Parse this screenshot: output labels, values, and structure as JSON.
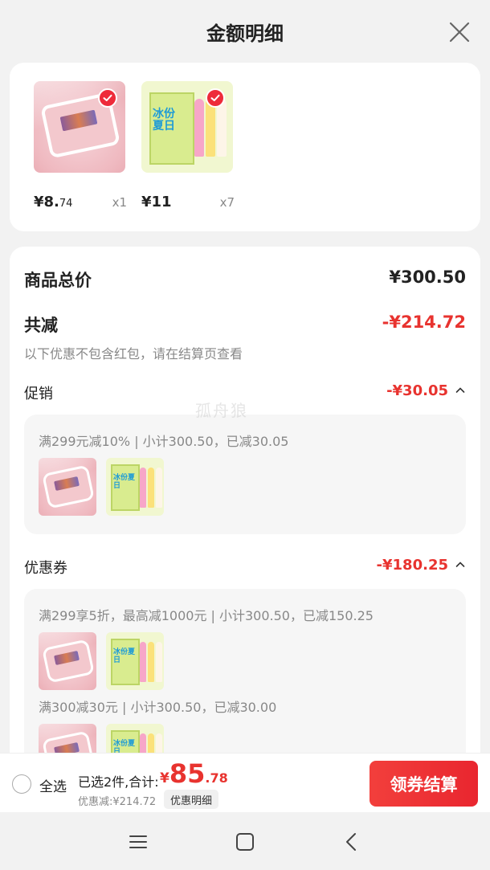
{
  "header": {
    "title": "金额明细"
  },
  "products": [
    {
      "price_main": "¥8.",
      "price_small": "74",
      "qty": "x1",
      "image": "pink-ice-cream-boxes"
    },
    {
      "price_main": "¥11",
      "price_small": "",
      "qty": "x7",
      "image": "green-popsicle-box",
      "box_text": "冰份夏日"
    }
  ],
  "summary": {
    "total_label": "商品总价",
    "total_value": "¥300.50",
    "reduce_label": "共减",
    "reduce_value": "-¥214.72",
    "note": "以下优惠不包含红包，请在结算页查看"
  },
  "promo": {
    "label": "促销",
    "value": "-¥30.05",
    "rule": "满299元减10% | 小计300.50，已减30.05"
  },
  "coupon": {
    "label": "优惠券",
    "value": "-¥180.25",
    "rule1": "满299享5折，最高减1000元 | 小计300.50，已减150.25",
    "rule2": "满300减30元 | 小计300.50，已减30.00"
  },
  "watermark": "孤舟狼",
  "bottom": {
    "select_all": "全选",
    "selected": "已选2件,合计:",
    "currency": "¥",
    "total_int": "85",
    "total_dec": ".78",
    "discount": "优惠减:¥214.72",
    "detail_chip": "优惠明细",
    "checkout": "领券结算"
  },
  "colors": {
    "accent": "#e8332f",
    "button": "#ee2b35",
    "card": "#ffffff",
    "page": "#f2f2f2"
  }
}
